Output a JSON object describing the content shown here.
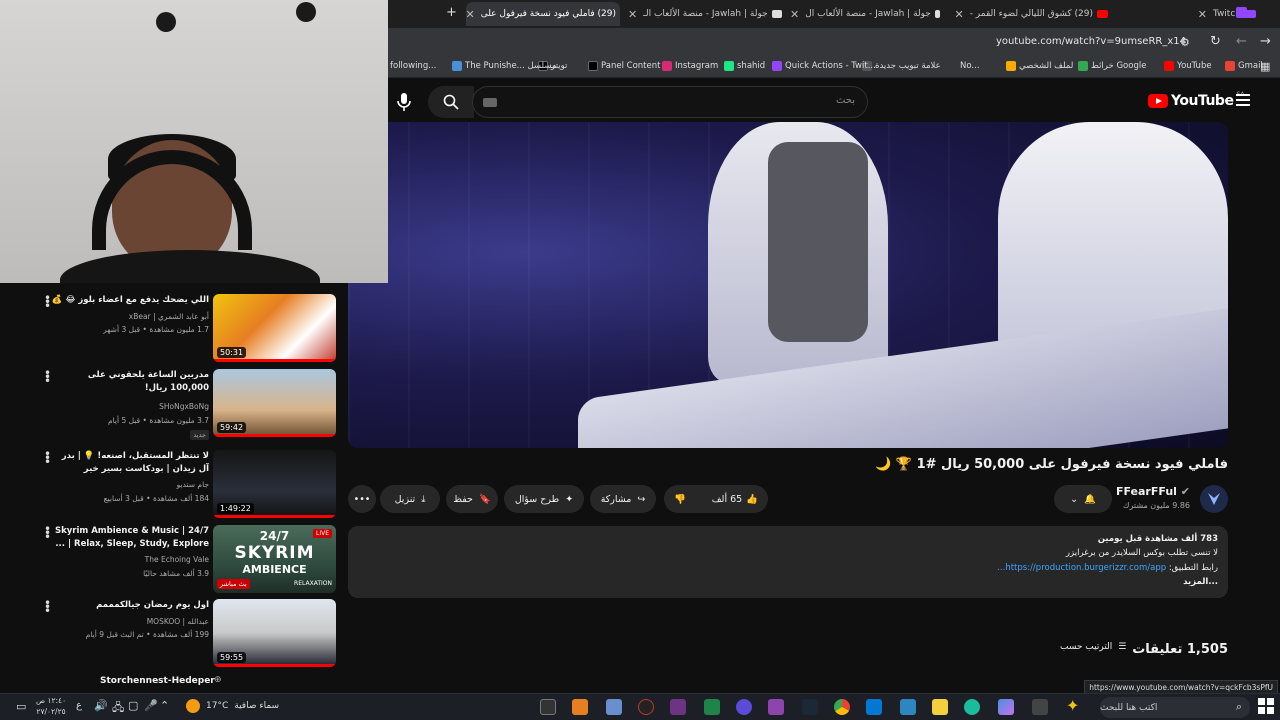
{
  "tabs": [
    {
      "label": "Twitch"
    },
    {
      "label": "(29) كشوق الليالي لضوء القمر -"
    },
    {
      "label": "جولة | Jawlah - منصة الألعاب ال"
    },
    {
      "label": "جولة | Jawlah - منصة الألعاب الـ"
    },
    {
      "label": "(29) فاملي فيود نسخة فيرفول على"
    }
  ],
  "address": {
    "url": "youtube.com/watch?v=9umseRR_x14"
  },
  "bookmarks": [
    "Gmail",
    "YouTube",
    "خرائط Google",
    "لملف الشخصي",
    "No...",
    "علامة تبويب جديدة",
    "Quick Actions - Twit...",
    "shahid",
    "Instagram",
    "Panel Content",
    "تويتر",
    "The Punishe... مسلسل",
    "following..."
  ],
  "header": {
    "search_placeholder": "بحث",
    "logo": "YouTube",
    "region": "SA"
  },
  "video": {
    "title": "فاملي فيود نسخة فيرفول على 50,000 ريال #1 🏆 🌙",
    "channel": "FFearFFul",
    "subscribers": "9.86 مليون مشترك",
    "likes": "65 ألف",
    "share": "مشاركة",
    "ask": "طرح سؤال",
    "save": "حفظ",
    "download": "تنزيل"
  },
  "description": {
    "stats": "783 ألف مشاهدة  قبل يومين",
    "line1": "لا تنسى تطلب بوكس السلايدر من برغرايزر",
    "line2_label": "رابط التطبيق:",
    "line2_link": "https://production.burgerizzr.com/app...",
    "more": "...المزيد"
  },
  "comments": {
    "count": "1,505 تعليقات",
    "sort": "الترتيب حسب"
  },
  "related": [
    {
      "title": "اللي يضحك يدفع مع اعضاء بلوز 😂 💰",
      "channel": "أبو عابد الشمري | xBear",
      "meta": "1.7 مليون مشاهدة • قبل 3 أشهر",
      "duration": "50:31",
      "badge": ""
    },
    {
      "title": "مدربين الساعة يلحقوني على 100,000 ريال!",
      "channel": "SHoNgxBoNg",
      "meta": "3.7 مليون مشاهدة • قبل 5 أيام",
      "duration": "59:42",
      "badge": "جديد"
    },
    {
      "title": "لا تنتظر المستقبل، اصنعه! 💡 | بدر آل زيدان | بودكاست بسير خير",
      "channel": "جام ستديو",
      "meta": "184 ألف مشاهدة • قبل 3 أسابيع",
      "duration": "1:49:22",
      "badge": ""
    },
    {
      "title": "24/7 Skyrim Ambience & Music | Relax, Sleep, Study, Explore | ...",
      "channel": "The Echoing Vale",
      "meta": "3.9 ألف مشاهد حاليًا",
      "duration": "",
      "badge": "بث مباشر"
    },
    {
      "title": "اول يوم رمضان جيالكمممم",
      "channel": "عبدالله | MOSKOO",
      "meta": "199 ألف مشاهدة • تم البث قبل 9 أيام",
      "duration": "59:55",
      "badge": ""
    },
    {
      "title": "Storchennest-Hedeper",
      "channel": "",
      "meta": "",
      "duration": "",
      "badge": ""
    }
  ],
  "thumb_text": {
    "skyrim_top": "24/7",
    "skyrim_main": "SKYRIM",
    "skyrim_sub": "AMBIENCE",
    "skyrim_relax": "RELAXATION",
    "live": "LIVE"
  },
  "taskbar": {
    "search": "اكتب هنا للبحث",
    "weather": "سماء صافية",
    "temp": "17°C",
    "time": "١٢:٤٠ ص",
    "date": "٢٧/٠٢/٢٥"
  },
  "status_url": "https://www.youtube.com/watch?v=qckFcb3sPfU",
  "colors": {
    "accent": "#ff0000",
    "link": "#3ea6ff",
    "bg": "#0f0f0f"
  }
}
